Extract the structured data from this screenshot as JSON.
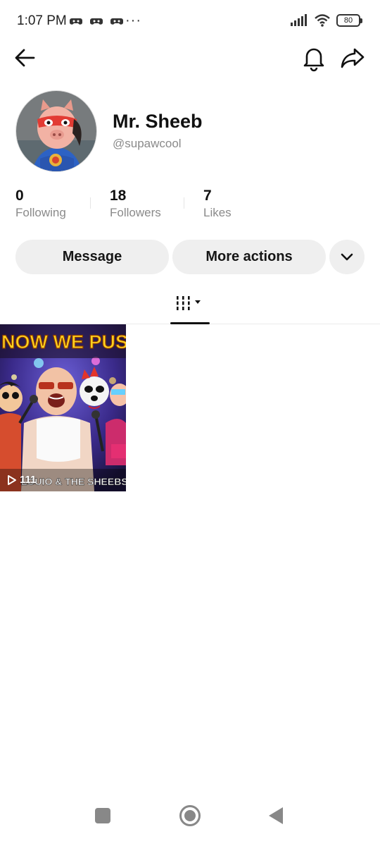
{
  "status_bar": {
    "time": "1:07 PM",
    "dots": "···",
    "battery": "80"
  },
  "profile": {
    "display_name": "Mr. Sheeb",
    "handle": "@supawcool"
  },
  "stats": [
    {
      "count": "0",
      "label": "Following"
    },
    {
      "count": "18",
      "label": "Followers"
    },
    {
      "count": "7",
      "label": "Likes"
    }
  ],
  "actions": {
    "message": "Message",
    "more_actions": "More actions"
  },
  "videos": [
    {
      "title_text": "NOW WE PUS",
      "caption_text": "LOUIO & THE SHEEBS",
      "views": "111"
    }
  ],
  "icons": {
    "back": "arrow-left-icon",
    "bell": "bell-icon",
    "share": "share-icon",
    "dropdown": "chevron-down-icon",
    "tab": "video-grid-icon"
  }
}
